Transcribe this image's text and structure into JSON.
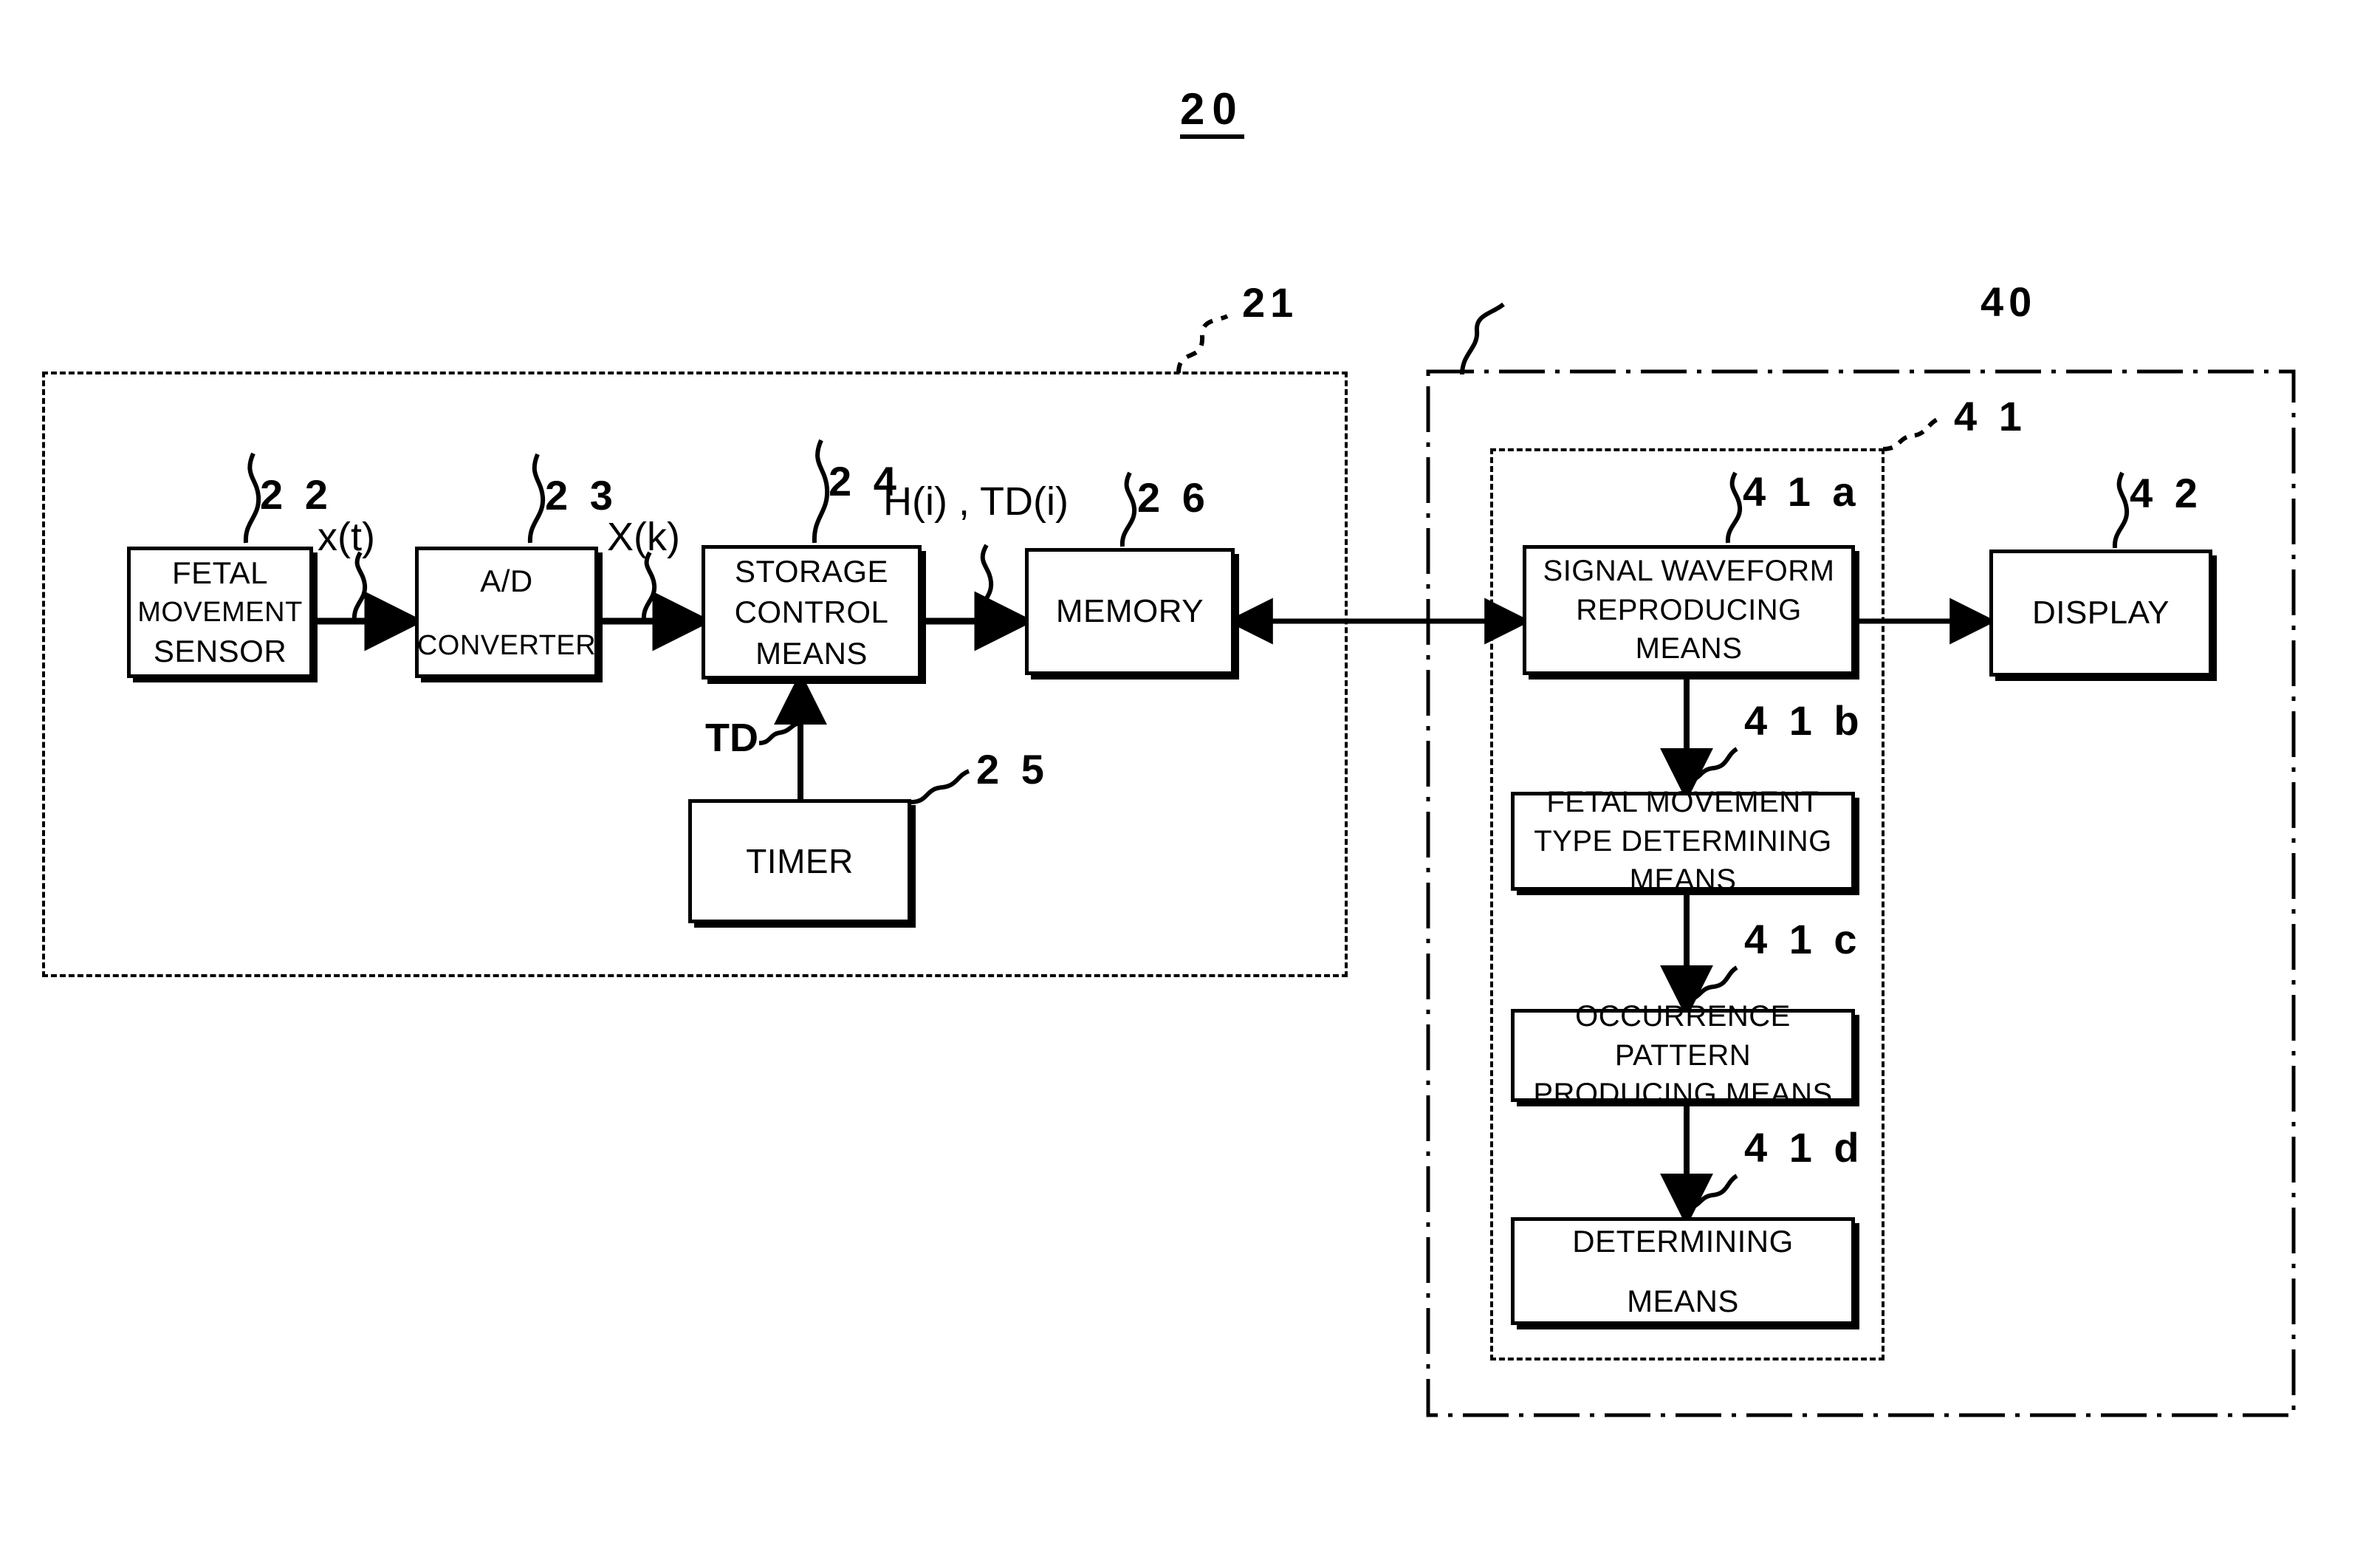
{
  "figure": {
    "title": "20",
    "domain_note": "patent block diagram"
  },
  "reference_labels": {
    "fig": "20",
    "detecting_unit": "21",
    "sensor": "2 2",
    "ad_converter": "2 3",
    "storage_control": "2 4",
    "timer": "2 5",
    "memory": "2 6",
    "analysis_unit": "40",
    "processor": "4 1",
    "waveform": "4 1 a",
    "movement_type": "4 1 b",
    "occurrence_pattern": "4 1 c",
    "determining": "4 1 d",
    "display": "4 2"
  },
  "blocks": {
    "sensor": {
      "lines": [
        "FETAL",
        "MOVEMENT",
        "SENSOR"
      ]
    },
    "ad_converter": {
      "lines": [
        "A/D",
        "CONVERTER"
      ]
    },
    "storage_control": {
      "lines": [
        "STORAGE",
        "CONTROL",
        "MEANS"
      ]
    },
    "memory": {
      "lines": [
        "MEMORY"
      ]
    },
    "timer": {
      "lines": [
        "TIMER"
      ]
    },
    "waveform": {
      "lines": [
        "SIGNAL WAVEFORM",
        "REPRODUCING",
        "MEANS"
      ]
    },
    "movement_type": {
      "lines": [
        "FETAL MOVEMENT",
        "TYPE DETERMINING",
        "MEANS"
      ]
    },
    "occurrence_pattern": {
      "lines": [
        "OCCURRENCE",
        "PATTERN",
        "PRODUCING MEANS"
      ]
    },
    "determining": {
      "lines": [
        "DETERMINING",
        "MEANS"
      ]
    },
    "display": {
      "lines": [
        "DISPLAY"
      ]
    }
  },
  "signals": {
    "xt": "x(t)",
    "xk": "X(k)",
    "h_td": "H(i) , TD(i)",
    "td": "TD"
  },
  "colors": {
    "ink": "#000000",
    "paper": "#ffffff"
  }
}
